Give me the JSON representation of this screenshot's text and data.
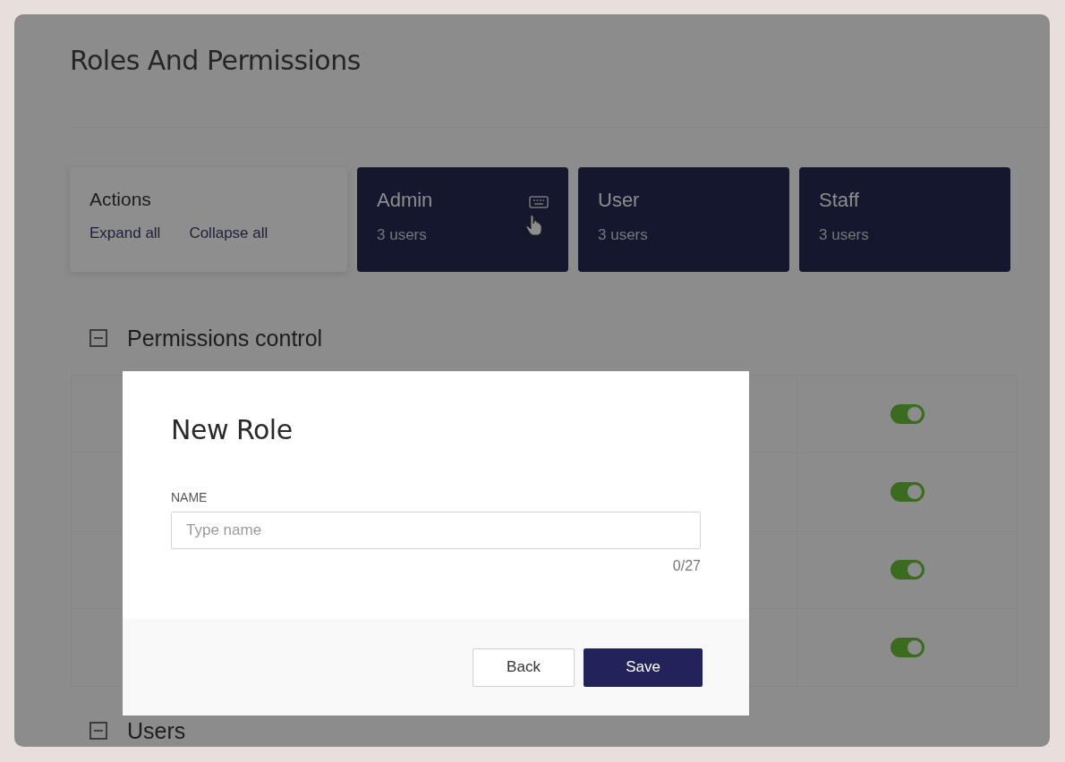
{
  "page": {
    "title": "Roles And Permissions"
  },
  "actions": {
    "title": "Actions",
    "links": [
      "Expand all",
      "Collapse all"
    ]
  },
  "roles": [
    {
      "name": "Admin",
      "count": "3 users",
      "hovered": true
    },
    {
      "name": "User",
      "count": "3 users",
      "hovered": false
    },
    {
      "name": "Staff",
      "count": "3 users",
      "hovered": false
    }
  ],
  "sections": [
    {
      "title": "Permissions control",
      "expanded": true,
      "rows": [
        {
          "on": true
        },
        {
          "on": true
        },
        {
          "on": true
        },
        {
          "on": true
        }
      ]
    },
    {
      "title": "Users",
      "expanded": true
    }
  ],
  "modal": {
    "title": "New Role",
    "field": {
      "label": "NAME",
      "placeholder": "Type name",
      "counter": "0/27"
    },
    "buttons": [
      {
        "label": "Back",
        "kind": "secondary"
      },
      {
        "label": "Save",
        "kind": "primary"
      }
    ]
  }
}
